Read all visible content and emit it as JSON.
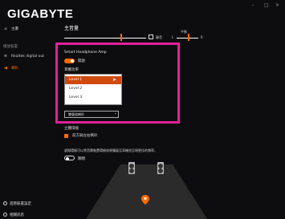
{
  "app": {
    "brand": "GIGABYTE",
    "window_controls": [
      "-",
      "□",
      "×"
    ]
  },
  "sidebar": {
    "home": "主畫",
    "category": "播放裝置",
    "device": "Realtek digital out",
    "active_item": "喇叭",
    "bottom_items": [
      "進階裝置設定",
      "相關訊息"
    ]
  },
  "main": {
    "title": "主音量",
    "mute_label": "靜音",
    "balance_label": "平衡",
    "balance_left": "L",
    "balance_right": "R"
  },
  "headphone_amp": {
    "title": "Smart Headphone Amp",
    "toggle_label": "開啟",
    "toggle_on": true,
    "gain_label": "耳機功率",
    "options": [
      "Level 1",
      "Level 2",
      "Level 3"
    ],
    "selected_option": "Level 1",
    "select_value": "雙聲道喇叭"
  },
  "virtual": {
    "heading": "立體環繞",
    "checkbox_label": "前方與左右喇叭",
    "checkbox_checked": true,
    "description": "虛擬環繞可以將音響裝置環繞效果擴展至耳機並呈現更佳的頻率。",
    "toggle_label": "關閉",
    "toggle_on": false
  },
  "colors": {
    "accent": "#ff6a00",
    "highlight": "#e0219b",
    "selected_option": "#d0490f"
  }
}
